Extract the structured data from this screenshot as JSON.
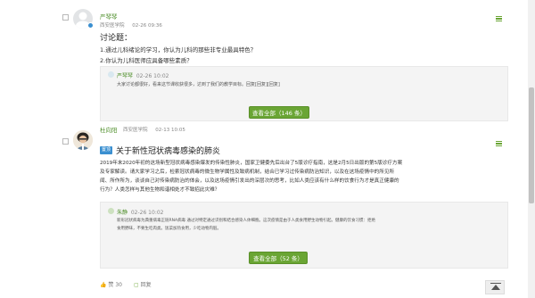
{
  "post1": {
    "author": "严琴琴",
    "org": "西安医学院",
    "time": "02-26 09:36",
    "title": "讨论题：",
    "lines": [
      "1.通过儿科绪论的学习，你认为儿科的那些非专业最具特色？",
      "2.你认为儿科医师应具备哪些素质？"
    ],
    "reply": {
      "author": "严琴琴",
      "time": "02-26 10:02",
      "text": "大家讨论都很好，看来这节课收获很多，达到了我们的教学目标。回复[回复][回复]"
    },
    "view_all": "查看全部（146 条）"
  },
  "post2": {
    "author": "杜向阳",
    "org": "西安医学院",
    "time": "02-13 10:05",
    "tag": "置顶",
    "title": "关于新性冠状病毒感染的肺炎",
    "lines": [
      "2019年末2020年初的这场新型冠状病毒感染爆发的传染性肺炎，国家卫健委先后出台了5版诊疗指南，这是2月5日出版的第5版诊疗方案",
      "及专家解读。请大家学习之后，检索冠状病毒的微生物学属性及致病机制，结合已学习过传染病防治知识，以及在这场疫情中的所见所",
      "闻、所作所为，谈谈自己对传染病防治的体会，以及这场疫情引发出的深层次的思考，比如人类应该有什么样的饮食行为才是真正健康的",
      "行为？人类怎样与其他生物和谐相处才不致招此灾难？"
    ],
    "reply": {
      "author": "朱静",
      "time": "02-26 10:02",
      "lines": [
        "新形冠状病毒为典重病毒正链RNA病毒 通过对特定通过识别和结合感染人体细胞。这次疫情是由于人类食用野生动物引起。健康的饮食习惯：拒绝",
        "食用野味，不要生吃肉类。饭菜加热食用，少吃动物内脏。"
      ]
    },
    "view_all": "查看全部（52 条）"
  },
  "footer": {
    "likes": "赞 30",
    "reply": "回复"
  },
  "colors": {
    "accent": "#6aa534",
    "tag": "#3a8fd0"
  }
}
